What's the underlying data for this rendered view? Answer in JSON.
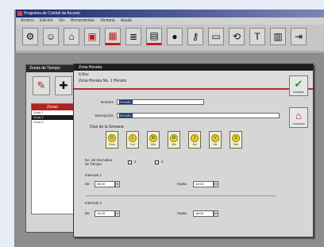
{
  "window": {
    "title": "Programa de Control de Acceso"
  },
  "menu": [
    "Archivo",
    "Edición",
    "Ver",
    "Herramientas",
    "Ventana",
    "Ayuda"
  ],
  "toolbar": {
    "items": [
      {
        "icon": "settings-icon",
        "glyph": "⚙"
      },
      {
        "icon": "users-icon",
        "glyph": "☺"
      },
      {
        "icon": "building-icon",
        "glyph": "⌂"
      },
      {
        "icon": "door-icon",
        "glyph": "▣"
      },
      {
        "icon": "calendar-icon",
        "glyph": "▦"
      },
      {
        "icon": "report-icon",
        "glyph": "≣"
      },
      {
        "icon": "schedule-icon",
        "glyph": "▤"
      },
      {
        "icon": "globe-icon",
        "glyph": "●"
      },
      {
        "icon": "key-icon",
        "glyph": "⚷"
      },
      {
        "icon": "monitor-icon",
        "glyph": "▭"
      },
      {
        "icon": "network-icon",
        "glyph": "⟲"
      },
      {
        "icon": "sign-icon",
        "glyph": "T"
      },
      {
        "icon": "grid-icon",
        "glyph": "▥"
      },
      {
        "icon": "exit-icon",
        "glyph": "⇥"
      }
    ]
  },
  "back_window": {
    "title": "Zonas de Tiempo",
    "list_header": "Zonas",
    "list_items": [
      "Zona 1",
      "Zona 2",
      "Zona 3"
    ]
  },
  "dialog": {
    "title": "Zona Horaria",
    "header_line1": "Editar",
    "header_line2": "Zona Horaria No. 1 Horario",
    "name_label": "Nombre",
    "name_value": "Horario",
    "desc_label": "Descripción",
    "desc_value": "Horario",
    "days_label": "Días de la Semana",
    "days": [
      {
        "face": "D",
        "label": "Dom"
      },
      {
        "face": "L",
        "label": "Lun"
      },
      {
        "face": "M",
        "label": "Mar"
      },
      {
        "face": "M",
        "label": "Mié"
      },
      {
        "face": "J",
        "label": "Jue"
      },
      {
        "face": "V",
        "label": "Vie"
      },
      {
        "face": "S",
        "label": "Sáb"
      }
    ],
    "intervals_label": "No. de Intervalos de Tiempo",
    "opt1": "1",
    "opt2": "2",
    "interval1_label": "Intervalo 1",
    "interval2_label": "Intervalo 2",
    "from_label": "De",
    "to_label": "Hasta",
    "from1": "08:00",
    "to1": "12:00",
    "from2": "14:00",
    "to2": "18:00",
    "ok_label": "Aceptar",
    "cancel_label": "Cancelar"
  },
  "colors": {
    "accent": "#b22222",
    "title_bar": "#1c2a6e",
    "highlight": "#0b2a6e"
  }
}
